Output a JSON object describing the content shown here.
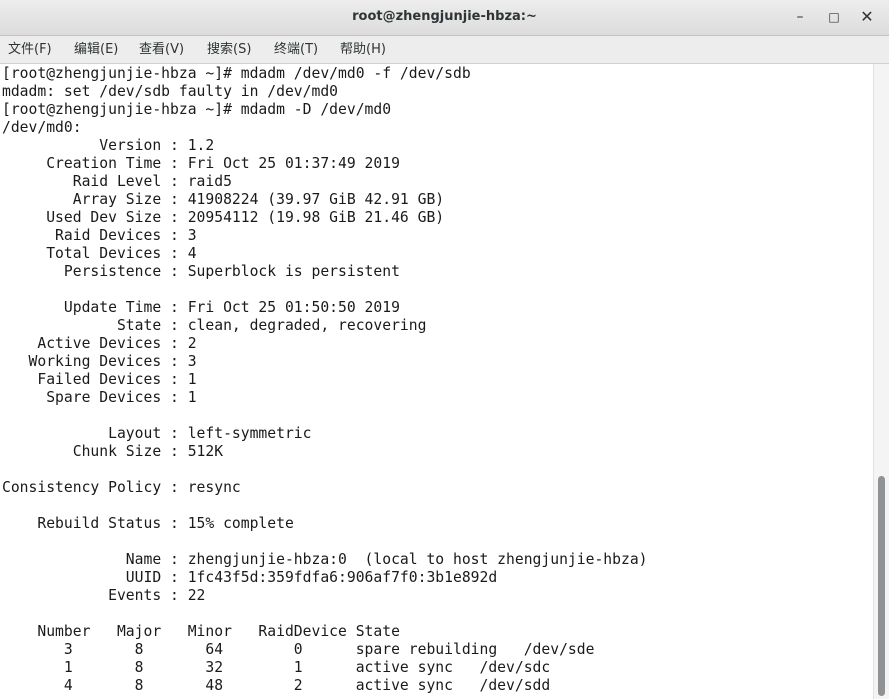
{
  "window": {
    "title": "root@zhengjunjie-hbza:~",
    "minimize_icon": "minimize-icon",
    "maximize_icon": "maximize-icon",
    "close_icon": "close-icon",
    "minimize_glyph": "–",
    "maximize_glyph": "□",
    "close_glyph": "✕"
  },
  "menu": {
    "items": [
      {
        "label": "文件(F)"
      },
      {
        "label": "编辑(E)"
      },
      {
        "label": "查看(V)"
      },
      {
        "label": "搜索(S)"
      },
      {
        "label": "终端(T)"
      },
      {
        "label": "帮助(H)"
      }
    ]
  },
  "terminal": {
    "lines": [
      "[root@zhengjunjie-hbza ~]# mdadm /dev/md0 -f /dev/sdb",
      "mdadm: set /dev/sdb faulty in /dev/md0",
      "[root@zhengjunjie-hbza ~]# mdadm -D /dev/md0",
      "/dev/md0:",
      "           Version : 1.2",
      "     Creation Time : Fri Oct 25 01:37:49 2019",
      "        Raid Level : raid5",
      "        Array Size : 41908224 (39.97 GiB 42.91 GB)",
      "     Used Dev Size : 20954112 (19.98 GiB 21.46 GB)",
      "      Raid Devices : 3",
      "     Total Devices : 4",
      "       Persistence : Superblock is persistent",
      "",
      "       Update Time : Fri Oct 25 01:50:50 2019",
      "             State : clean, degraded, recovering",
      "    Active Devices : 2",
      "   Working Devices : 3",
      "    Failed Devices : 1",
      "     Spare Devices : 1",
      "",
      "            Layout : left-symmetric",
      "        Chunk Size : 512K",
      "",
      "Consistency Policy : resync",
      "",
      "    Rebuild Status : 15% complete",
      "",
      "              Name : zhengjunjie-hbza:0  (local to host zhengjunjie-hbza)",
      "              UUID : 1fc43f5d:359fdfa6:906af7f0:3b1e892d",
      "            Events : 22",
      "",
      "    Number   Major   Minor   RaidDevice State",
      "       3       8       64        0      spare rebuilding   /dev/sde",
      "       1       8       32        1      active sync   /dev/sdc",
      "       4       8       48        2      active sync   /dev/sdd"
    ]
  },
  "colors": {
    "terminal_bg": "#ffffff",
    "terminal_fg": "#1a1a1a",
    "titlebar_bg": "#e4e4e4",
    "menubar_bg": "#ededed"
  }
}
